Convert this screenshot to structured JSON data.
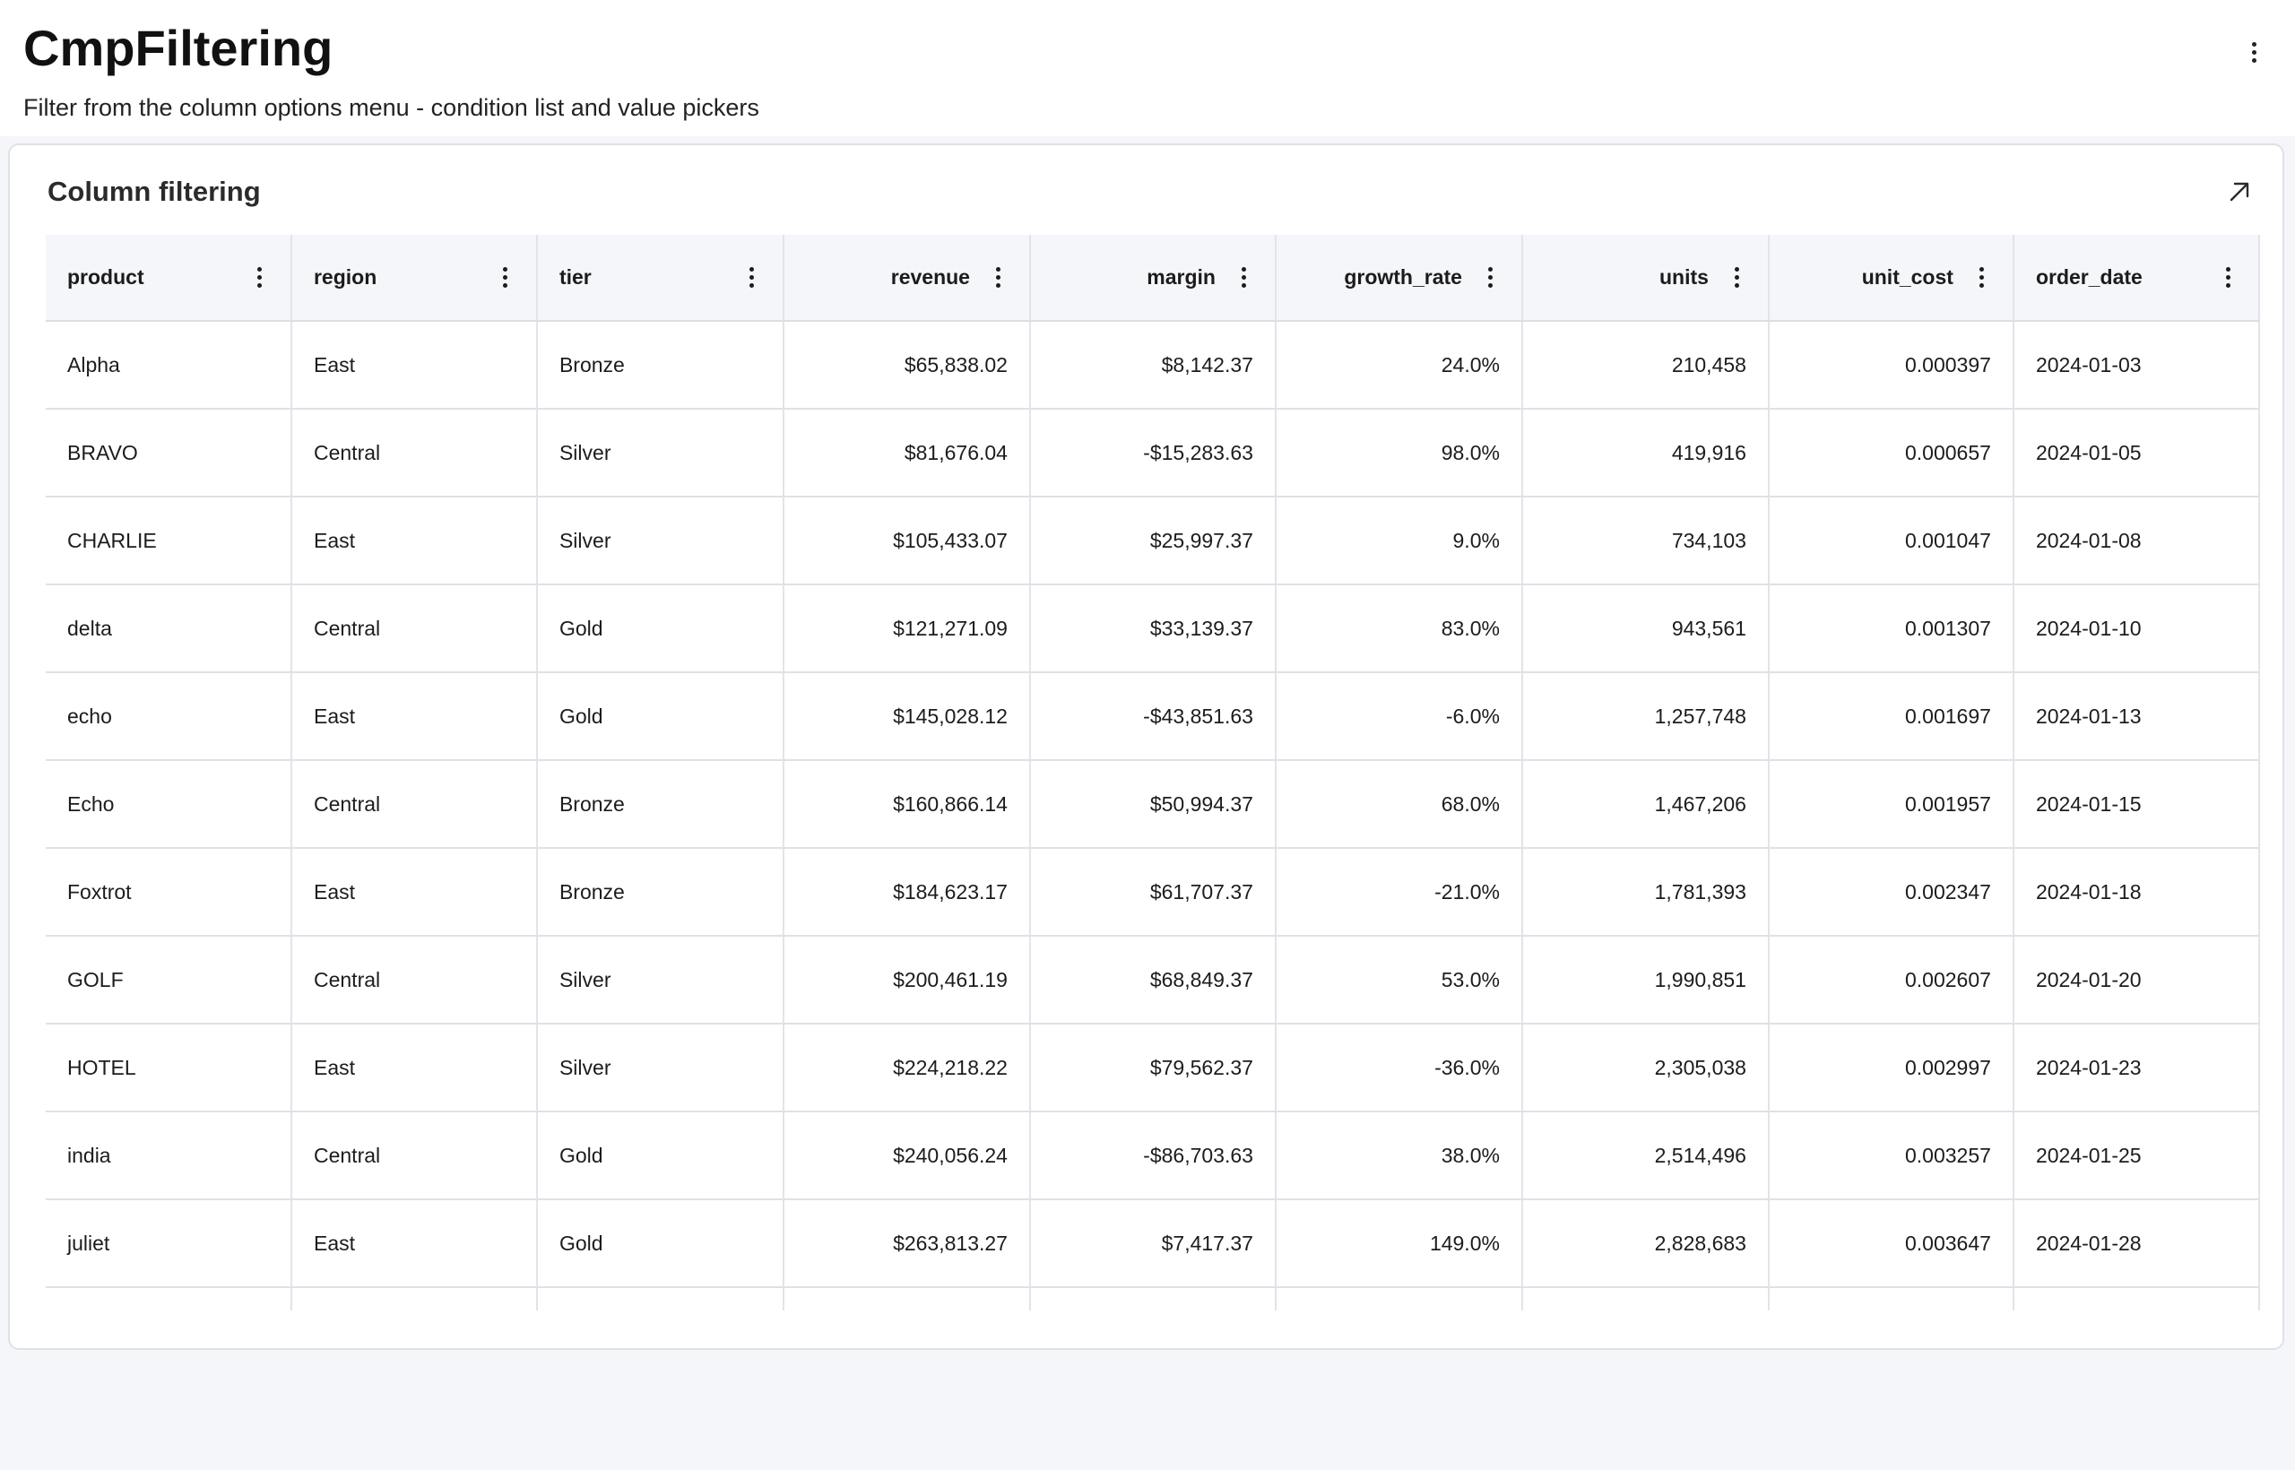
{
  "header": {
    "title": "CmpFiltering",
    "subtitle": "Filter from the column options menu - condition list and value pickers"
  },
  "card": {
    "title": "Column filtering"
  },
  "table": {
    "columns": [
      {
        "key": "product",
        "label": "product",
        "align": "left"
      },
      {
        "key": "region",
        "label": "region",
        "align": "left"
      },
      {
        "key": "tier",
        "label": "tier",
        "align": "left"
      },
      {
        "key": "revenue",
        "label": "revenue",
        "align": "right"
      },
      {
        "key": "margin",
        "label": "margin",
        "align": "right"
      },
      {
        "key": "growth_rate",
        "label": "growth_rate",
        "align": "right"
      },
      {
        "key": "units",
        "label": "units",
        "align": "right"
      },
      {
        "key": "unit_cost",
        "label": "unit_cost",
        "align": "right"
      },
      {
        "key": "order_date",
        "label": "order_date",
        "align": "left"
      }
    ],
    "rows": [
      [
        "Alpha",
        "East",
        "Bronze",
        "$65,838.02",
        "$8,142.37",
        "24.0%",
        "210,458",
        "0.000397",
        "2024-01-03"
      ],
      [
        "BRAVO",
        "Central",
        "Silver",
        "$81,676.04",
        "-$15,283.63",
        "98.0%",
        "419,916",
        "0.000657",
        "2024-01-05"
      ],
      [
        "CHARLIE",
        "East",
        "Silver",
        "$105,433.07",
        "$25,997.37",
        "9.0%",
        "734,103",
        "0.001047",
        "2024-01-08"
      ],
      [
        "delta",
        "Central",
        "Gold",
        "$121,271.09",
        "$33,139.37",
        "83.0%",
        "943,561",
        "0.001307",
        "2024-01-10"
      ],
      [
        "echo",
        "East",
        "Gold",
        "$145,028.12",
        "-$43,851.63",
        "-6.0%",
        "1,257,748",
        "0.001697",
        "2024-01-13"
      ],
      [
        "Echo",
        "Central",
        "Bronze",
        "$160,866.14",
        "$50,994.37",
        "68.0%",
        "1,467,206",
        "0.001957",
        "2024-01-15"
      ],
      [
        "Foxtrot",
        "East",
        "Bronze",
        "$184,623.17",
        "$61,707.37",
        "-21.0%",
        "1,781,393",
        "0.002347",
        "2024-01-18"
      ],
      [
        "GOLF",
        "Central",
        "Silver",
        "$200,461.19",
        "$68,849.37",
        "53.0%",
        "1,990,851",
        "0.002607",
        "2024-01-20"
      ],
      [
        "HOTEL",
        "East",
        "Silver",
        "$224,218.22",
        "$79,562.37",
        "-36.0%",
        "2,305,038",
        "0.002997",
        "2024-01-23"
      ],
      [
        "india",
        "Central",
        "Gold",
        "$240,056.24",
        "-$86,703.63",
        "38.0%",
        "2,514,496",
        "0.003257",
        "2024-01-25"
      ],
      [
        "juliet",
        "East",
        "Gold",
        "$263,813.27",
        "$7,417.37",
        "149.0%",
        "2,828,683",
        "0.003647",
        "2024-01-28"
      ]
    ]
  },
  "icons": {
    "header_menu": "more-vertical-icon",
    "expand": "open-in-new-arrow-icon",
    "column_menu": "more-vertical-icon"
  }
}
